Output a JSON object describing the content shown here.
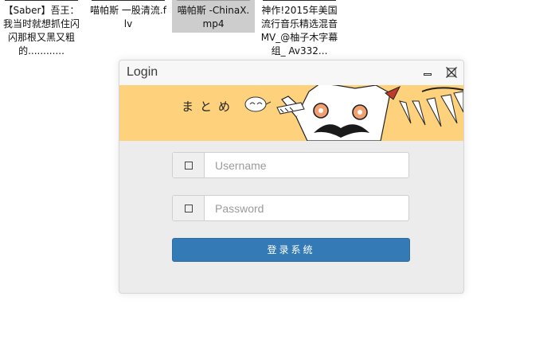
{
  "desktop": {
    "files": [
      {
        "caption": "【Saber】吾王：我当时就想抓住闪闪那根又黑又粗的............",
        "selected": false
      },
      {
        "caption": "喵帕斯 一股清流.flv",
        "selected": false
      },
      {
        "caption": "喵帕斯 -ChinaX.mp4",
        "selected": true
      },
      {
        "caption": "神作!2015年美国流行音乐精选混音MV_@柚子木字幕组_ Av332...",
        "selected": false
      }
    ]
  },
  "dialog": {
    "title": "Login",
    "banner_text": "まとめ",
    "banner_bg": "#fed27c",
    "username": {
      "placeholder": "Username",
      "value": ""
    },
    "password": {
      "placeholder": "Password",
      "value": ""
    },
    "login_button": "登录系统",
    "accent": "#337ab7"
  }
}
